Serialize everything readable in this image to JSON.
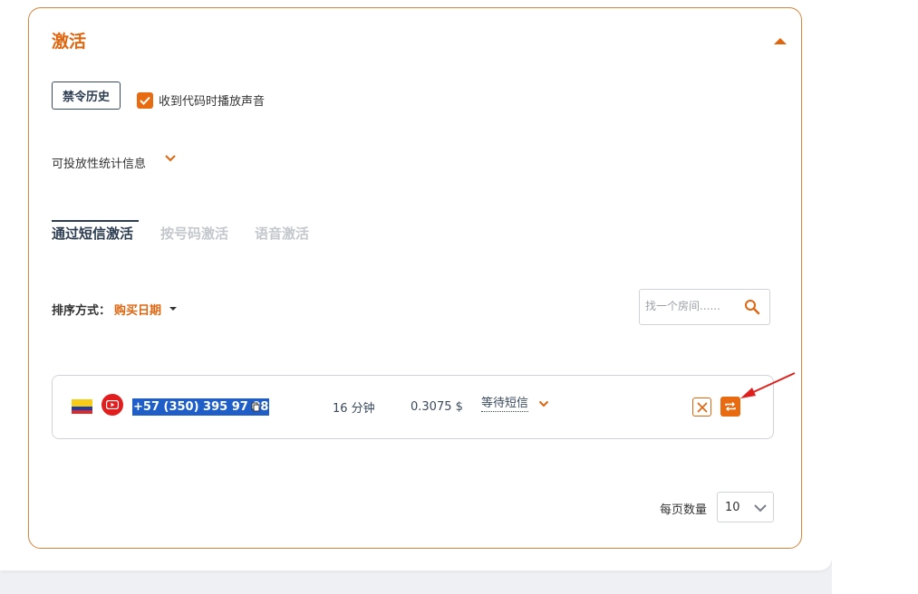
{
  "panel": {
    "title": "激活",
    "ban_history_button": "禁令历史",
    "sound_checkbox_label": "收到代码时播放声音",
    "sound_checkbox_checked": true,
    "stats_label": "可投放性统计信息"
  },
  "tabs": [
    {
      "label": "通过短信激活",
      "active": true
    },
    {
      "label": "按号码激活",
      "active": false
    },
    {
      "label": "语音激活",
      "active": false
    }
  ],
  "sort": {
    "label": "排序方式：",
    "value": "购买日期"
  },
  "search": {
    "placeholder": "找一个房间......"
  },
  "activations": [
    {
      "phone": "+57 (350) 395 97 08",
      "duration": "16 分钟",
      "price": "0.3075 $",
      "status": "等待短信",
      "country_flag": "colombia-flag-icon",
      "service_icon": "youtube-icon"
    }
  ],
  "pagination": {
    "per_page_label": "每页数量",
    "per_page_value": "10"
  },
  "colors": {
    "accent": "#e86b12",
    "dark": "#2e3e52",
    "highlight": "#1f5ec9",
    "arrow": "#e0201c"
  }
}
